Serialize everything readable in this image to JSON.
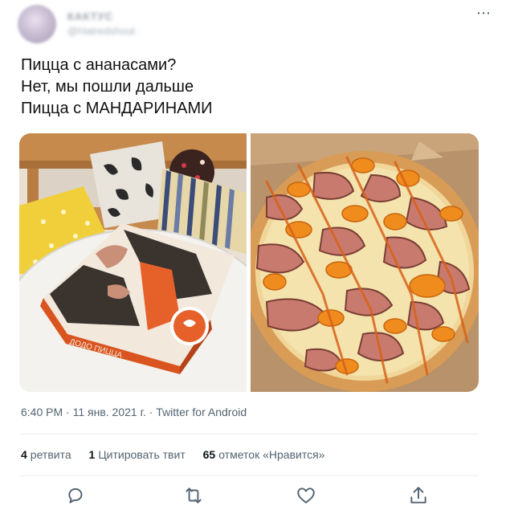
{
  "user": {
    "display_name": "КАКТУС",
    "handle": "@Hatredshout"
  },
  "more_icon": "⋯",
  "tweet": {
    "lines": [
      "Пицца с ананасами?",
      "Нет, мы пошли дальше",
      "Пицца с МАНДАРИНАМИ"
    ]
  },
  "media": {
    "box_brand_text": "ДОДО ПИЦЦА"
  },
  "meta": {
    "text": "6:40 PM · 11 янв. 2021 г. · Twitter for Android"
  },
  "stats": {
    "retweets_count": "4",
    "retweets_label": "ретвита",
    "quotes_count": "1",
    "quotes_label": "Цитировать твит",
    "likes_count": "65",
    "likes_label": "отметок «Нравится»"
  },
  "actions": [
    "reply-icon",
    "retweet-icon",
    "like-icon",
    "share-icon"
  ],
  "colors": {
    "text": "#0f1419",
    "secondary": "#536471",
    "divider": "#e6ecf0"
  }
}
